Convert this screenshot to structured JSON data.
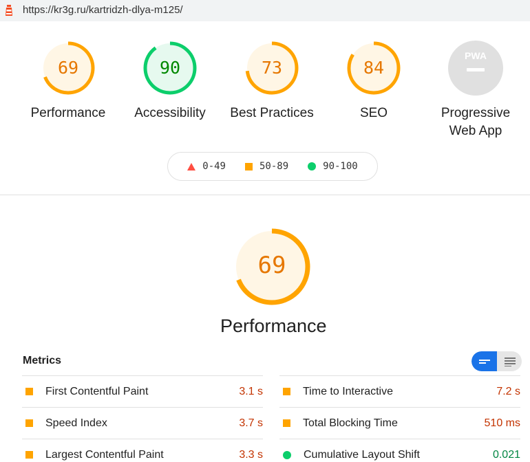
{
  "browser": {
    "url": "https://kr3g.ru/kartridzh-dlya-m125/"
  },
  "gauges": [
    {
      "score": "69",
      "value": 69,
      "label": "Performance",
      "status": "average"
    },
    {
      "score": "90",
      "value": 90,
      "label": "Accessibility",
      "status": "pass"
    },
    {
      "score": "73",
      "value": 73,
      "label": "Best Practices",
      "status": "average"
    },
    {
      "score": "84",
      "value": 84,
      "label": "SEO",
      "status": "average"
    }
  ],
  "pwa": {
    "badge": "PWA",
    "label_line1": "Progressive",
    "label_line2": "Web App"
  },
  "legend": [
    {
      "range": "0-49",
      "shape": "triangle"
    },
    {
      "range": "50-89",
      "shape": "square"
    },
    {
      "range": "90-100",
      "shape": "circle"
    }
  ],
  "performance": {
    "score": "69",
    "value": 69,
    "title": "Performance"
  },
  "metrics": {
    "title": "Metrics",
    "left": [
      {
        "name": "First Contentful Paint",
        "value": "3.1 s",
        "status": "average"
      },
      {
        "name": "Speed Index",
        "value": "3.7 s",
        "status": "average"
      },
      {
        "name": "Largest Contentful Paint",
        "value": "3.3 s",
        "status": "average"
      }
    ],
    "right": [
      {
        "name": "Time to Interactive",
        "value": "7.2 s",
        "status": "average"
      },
      {
        "name": "Total Blocking Time",
        "value": "510 ms",
        "status": "average"
      },
      {
        "name": "Cumulative Layout Shift",
        "value": "0.021",
        "status": "pass"
      }
    ]
  },
  "colors": {
    "average": "#ffa400",
    "average_text": "#e67700",
    "average_bg": "#fff6e5",
    "pass": "#0cce6b",
    "pass_text": "#008800",
    "pass_bg": "#e6f9ef",
    "fail": "#ff4e42",
    "pwa_bg": "#e0e0e0",
    "accent": "#1a73e8"
  }
}
